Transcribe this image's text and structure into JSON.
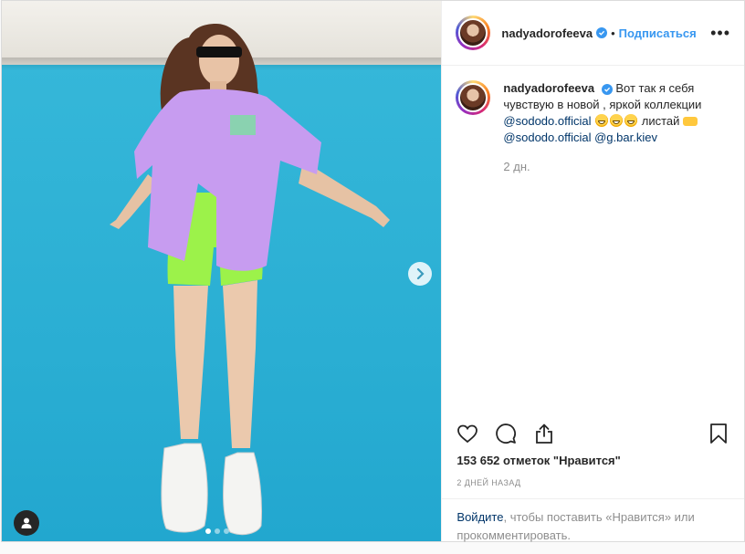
{
  "post": {
    "username": "nadyadorofeeva",
    "separator": "•",
    "follow_label": "Подписаться",
    "more_label": "•••",
    "caption": {
      "username": "nadyadorofeeva",
      "text1": "Вот так я себя чувствую в новой , яркой коллекции",
      "mention1": "@sododo.official",
      "text2": "листай",
      "mention2": "@sododo.official",
      "mention3": "@g.bar.kiev",
      "time_ago": "2 дн."
    },
    "likes_text": "153 652 отметок \"Нравится\"",
    "date_text": "2 ДНЕЙ НАЗАД",
    "login_link": "Войдите",
    "login_rest": ", чтобы поставить «Нравится» или прокомментировать.",
    "carousel": {
      "count": 3,
      "active": 0
    },
    "icons": {
      "like": "heart-icon",
      "comment": "comment-icon",
      "share": "share-icon",
      "save": "bookmark-icon",
      "next": "chevron-right-icon",
      "tags": "user-tag-icon",
      "verified": "verified-badge-icon"
    },
    "colors": {
      "accent": "#3897f0",
      "link": "#003569",
      "muted": "#8e8e8e",
      "media_bg": "#2fb2d6"
    }
  }
}
